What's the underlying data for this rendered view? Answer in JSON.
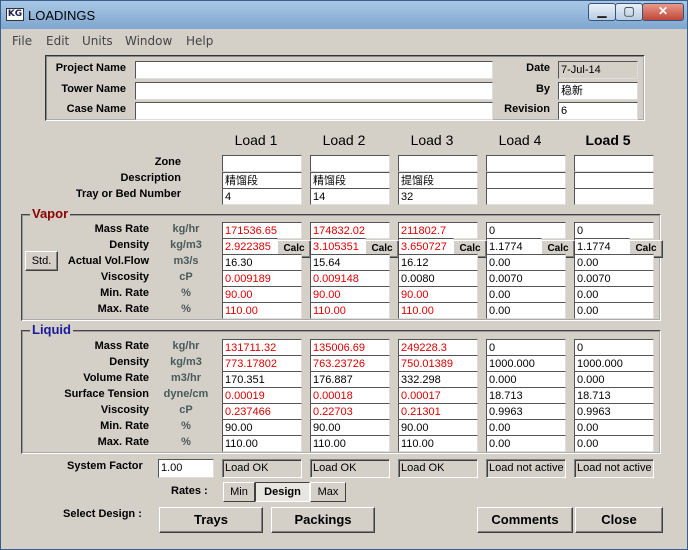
{
  "window": {
    "title": "LOADINGS",
    "icon_text": "KG",
    "min_glyph": "▁",
    "max_glyph": "▢",
    "close_glyph": "✕"
  },
  "menu": [
    "File",
    "Edit",
    "Units",
    "Window",
    "Help"
  ],
  "header": {
    "project_label": "Project Name",
    "project_value": "",
    "tower_label": "Tower Name",
    "tower_value": "",
    "case_label": "Case Name",
    "case_value": "",
    "date_label": "Date",
    "date_value": "7-Jul-14",
    "by_label": "By",
    "by_value": "稳新",
    "revision_label": "Revision",
    "revision_value": "6"
  },
  "loads": {
    "headers": [
      "Load 1",
      "Load 2",
      "Load 3",
      "Load 4",
      "Load 5"
    ],
    "zone_label": "Zone",
    "zone": [
      "",
      "",
      "",
      "",
      ""
    ],
    "description_label": "Description",
    "description": [
      "精馏段",
      "精馏段",
      "提馏段",
      "",
      ""
    ],
    "tray_label": "Tray or Bed Number",
    "tray": [
      "4",
      "14",
      "32",
      "",
      ""
    ]
  },
  "vapor": {
    "title": "Vapor",
    "std_button": "Std.",
    "calc_label": "Calc",
    "rows": [
      {
        "label": "Mass Rate",
        "unit": "kg/hr",
        "values": [
          "171536.65",
          "174832.02",
          "211802.7",
          "0",
          "0"
        ],
        "red": [
          true,
          true,
          true,
          false,
          false
        ]
      },
      {
        "label": "Density",
        "unit": "kg/m3",
        "values": [
          "2.922385",
          "3.105351",
          "3.650727",
          "1.1774",
          "1.1774"
        ],
        "red": [
          true,
          true,
          true,
          false,
          false
        ]
      },
      {
        "label": "Actual Vol.Flow",
        "unit": "m3/s",
        "values": [
          "16.30",
          "15.64",
          "16.12",
          "0.00",
          "0.00"
        ],
        "red": [
          false,
          false,
          false,
          false,
          false
        ]
      },
      {
        "label": "Viscosity",
        "unit": "cP",
        "values": [
          "0.009189",
          "0.009148",
          "0.0080",
          "0.0070",
          "0.0070"
        ],
        "red": [
          true,
          true,
          false,
          false,
          false
        ]
      },
      {
        "label": "Min. Rate",
        "unit": "%",
        "values": [
          "90.00",
          "90.00",
          "90.00",
          "0.00",
          "0.00"
        ],
        "red": [
          true,
          true,
          true,
          false,
          false
        ]
      },
      {
        "label": "Max. Rate",
        "unit": "%",
        "values": [
          "110.00",
          "110.00",
          "110.00",
          "0.00",
          "0.00"
        ],
        "red": [
          true,
          true,
          true,
          false,
          false
        ]
      }
    ]
  },
  "liquid": {
    "title": "Liquid",
    "rows": [
      {
        "label": "Mass Rate",
        "unit": "kg/hr",
        "values": [
          "131711.32",
          "135006.69",
          "249228.3",
          "0",
          "0"
        ],
        "red": [
          true,
          true,
          true,
          false,
          false
        ]
      },
      {
        "label": "Density",
        "unit": "kg/m3",
        "values": [
          "773.17802",
          "763.23726",
          "750.01389",
          "1000.000",
          "1000.000"
        ],
        "red": [
          true,
          true,
          true,
          false,
          false
        ]
      },
      {
        "label": "Volume Rate",
        "unit": "m3/hr",
        "values": [
          "170.351",
          "176.887",
          "332.298",
          "0.000",
          "0.000"
        ],
        "red": [
          false,
          false,
          false,
          false,
          false
        ]
      },
      {
        "label": "Surface Tension",
        "unit": "dyne/cm",
        "values": [
          "0.00019",
          "0.00018",
          "0.00017",
          "18.713",
          "18.713"
        ],
        "red": [
          true,
          true,
          true,
          false,
          false
        ]
      },
      {
        "label": "Viscosity",
        "unit": "cP",
        "values": [
          "0.237466",
          "0.22703",
          "0.21301",
          "0.9963",
          "0.9963"
        ],
        "red": [
          true,
          true,
          true,
          false,
          false
        ]
      },
      {
        "label": "Min. Rate",
        "unit": "%",
        "values": [
          "90.00",
          "90.00",
          "90.00",
          "0.00",
          "0.00"
        ],
        "red": [
          false,
          false,
          false,
          false,
          false
        ]
      },
      {
        "label": "Max. Rate",
        "unit": "%",
        "values": [
          "110.00",
          "110.00",
          "110.00",
          "0.00",
          "0.00"
        ],
        "red": [
          false,
          false,
          false,
          false,
          false
        ]
      }
    ]
  },
  "footer": {
    "system_factor_label": "System Factor",
    "system_factor_value": "1.00",
    "status": [
      "Load OK",
      "Load OK",
      "Load OK",
      "Load not active",
      "Load not active"
    ],
    "rates_label": "Rates :",
    "rates": [
      "Min",
      "Design",
      "Max"
    ],
    "rates_active": "Design",
    "select_design_label": "Select Design :",
    "trays_button": "Trays",
    "packings_button": "Packings",
    "comments_button": "Comments",
    "close_button": "Close"
  }
}
